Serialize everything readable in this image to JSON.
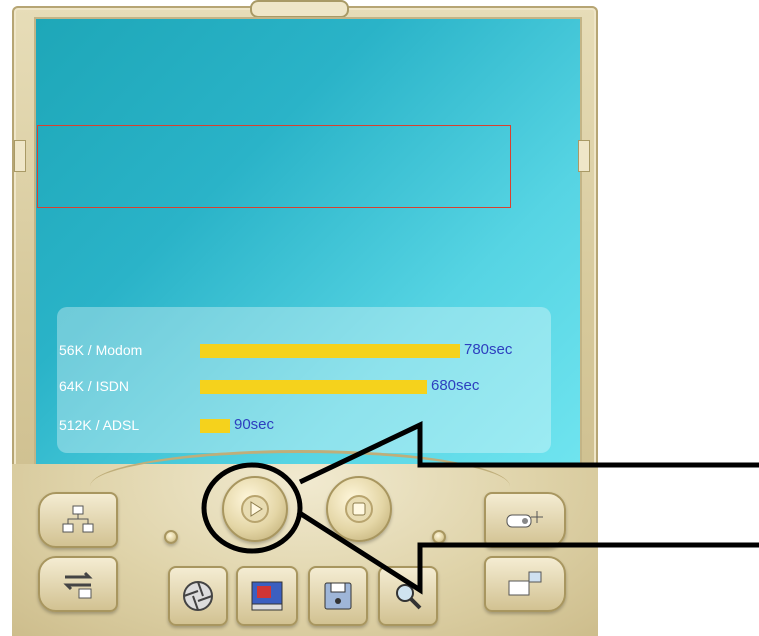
{
  "speed_panel": {
    "rows": [
      {
        "label": "56K / Modom",
        "value": "780sec",
        "fraction": 0.867
      },
      {
        "label": "64K / ISDN",
        "value": "680sec",
        "fraction": 0.756
      },
      {
        "label": "512K / ADSL",
        "value": "90sec",
        "fraction": 0.1
      }
    ]
  },
  "colors": {
    "bar": "#f5d21c",
    "value_text": "#2d3fbf",
    "highlight_box": "#d9402f",
    "screen": "#2ab3c8"
  },
  "icons": {
    "play": "play-icon",
    "stop": "stop-icon",
    "network": "network-icon",
    "transfer": "transfer-icon",
    "camera": "camera-shutter-icon",
    "media": "media-screen-icon",
    "save": "floppy-disk-icon",
    "zoom": "magnifier-icon",
    "projector": "projector-icon",
    "display": "display-icon"
  }
}
